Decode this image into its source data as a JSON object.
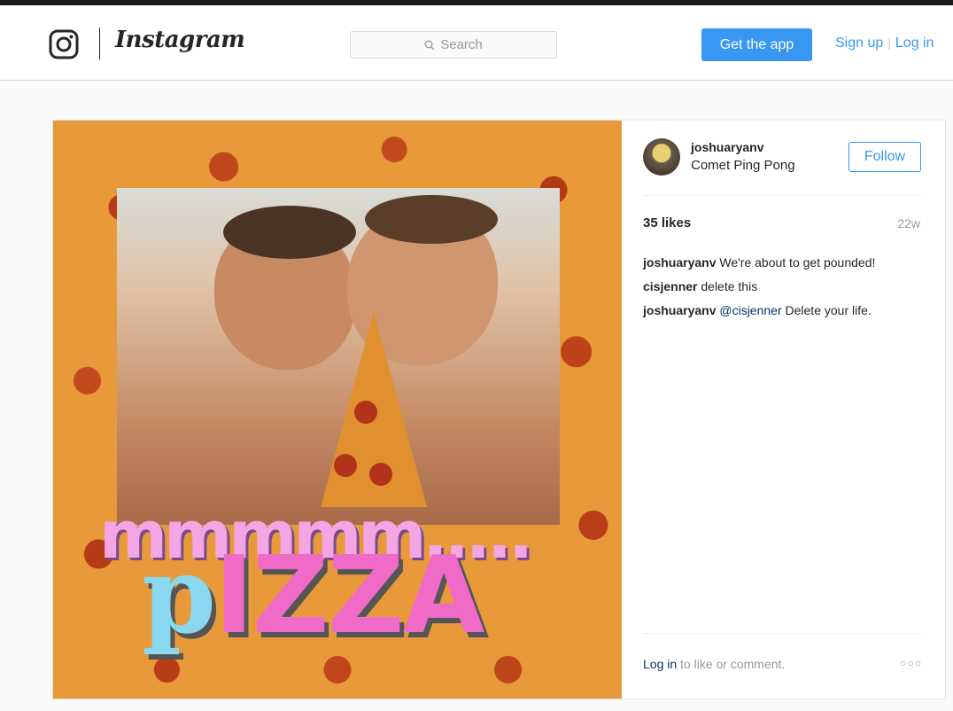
{
  "header": {
    "wordmark": "Instagram",
    "search_placeholder": "Search",
    "get_app": "Get the app",
    "sign_up": "Sign up",
    "separator": "|",
    "log_in": "Log in"
  },
  "post": {
    "image_text": {
      "line1": "mmmmm.....",
      "p": "p",
      "izza": "IZZA"
    },
    "username": "joshuaryanv",
    "location": "Comet Ping Pong",
    "follow_label": "Follow",
    "likes": "35 likes",
    "age": "22w",
    "comments": [
      {
        "user": "joshuaryanv",
        "mention": "",
        "text": "We're about to get pounded!"
      },
      {
        "user": "cisjenner",
        "mention": "",
        "text": "delete this"
      },
      {
        "user": "joshuaryanv",
        "mention": "@cisjenner",
        "text": "Delete your life."
      }
    ],
    "login_link": "Log in",
    "login_suffix": "to like or comment.",
    "more_label": "○○○"
  },
  "colors": {
    "accent": "#3897f0",
    "link": "#003569",
    "muted": "#999999"
  }
}
